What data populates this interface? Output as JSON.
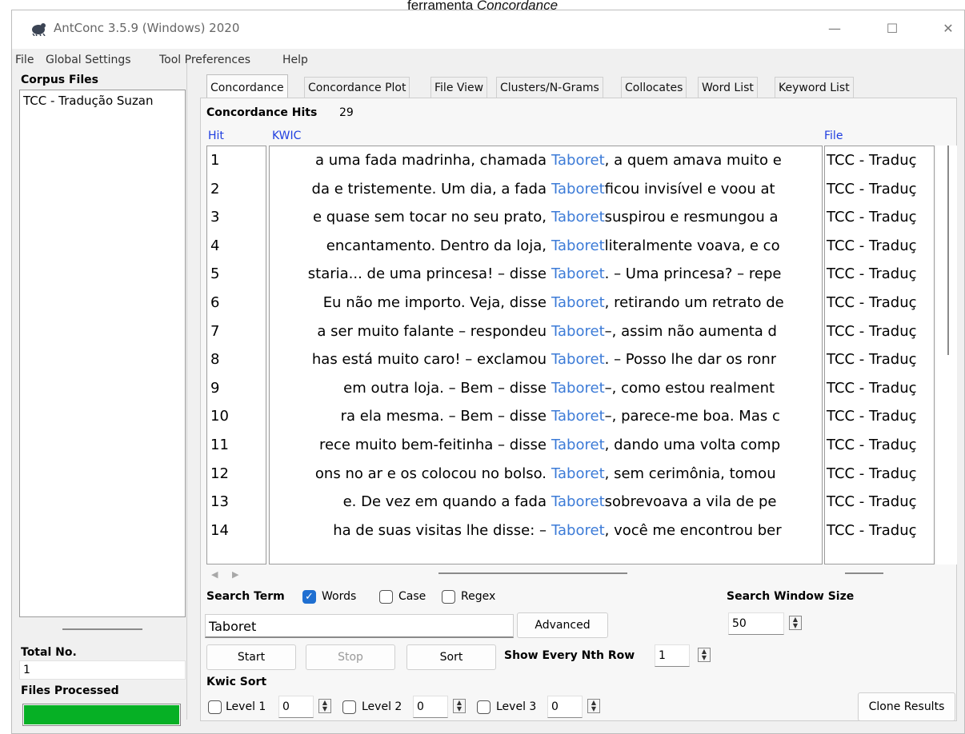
{
  "caption": {
    "main": "ferramenta",
    "italic": "Concordance"
  },
  "window": {
    "title": "AntConc 3.5.9 (Windows) 2020",
    "minimize": "—",
    "maximize": "☐",
    "close": "✕"
  },
  "menu": [
    "File",
    "Global Settings",
    "Tool Preferences",
    "Help"
  ],
  "left": {
    "corpus_files_label": "Corpus Files",
    "files": [
      "TCC - Tradução Suzan"
    ],
    "total_no_label": "Total No.",
    "total_no_value": "1",
    "files_processed_label": "Files Processed",
    "progress": 1.0
  },
  "tabs": [
    "Concordance",
    "Concordance Plot",
    "File View",
    "Clusters/N-Grams",
    "Collocates",
    "Word List",
    "Keyword List"
  ],
  "active_tab": "Concordance",
  "concordance": {
    "hits_label": "Concordance Hits",
    "hits_count": "29",
    "col_hit": "Hit",
    "col_kwic": "KWIC",
    "col_file": "File",
    "rows": [
      {
        "hit": "1",
        "left": "a uma fada madrinha, chamada",
        "keyword": "Taboret",
        "right": ", a quem amava muito e",
        "file": "TCC - Traduç"
      },
      {
        "hit": "2",
        "left": "da e tristemente.  Um dia, a fada",
        "keyword": "Taboret",
        "right": " ficou invisível e voou at",
        "file": "TCC - Traduç"
      },
      {
        "hit": "3",
        "left": "e quase sem tocar no seu prato,",
        "keyword": "Taboret",
        "right": " suspirou e resmungou a",
        "file": "TCC - Traduç"
      },
      {
        "hit": "4",
        "left": "encantamento.  Dentro da loja,",
        "keyword": "Taboret",
        "right": " literalmente voava, e co",
        "file": "TCC - Traduç"
      },
      {
        "hit": "5",
        "left": "staria... de uma princesa! – disse",
        "keyword": "Taboret",
        "right": ".  – Uma princesa? – repe",
        "file": "TCC - Traduç"
      },
      {
        "hit": "6",
        "left": "Eu não me importo. Veja, disse",
        "keyword": "Taboret",
        "right": ", retirando um retrato de",
        "file": "TCC - Traduç"
      },
      {
        "hit": "7",
        "left": "a ser muito falante – respondeu",
        "keyword": "Taboret",
        "right": " –, assim não aumenta d",
        "file": "TCC - Traduç"
      },
      {
        "hit": "8",
        "left": "has está muito caro! – exclamou",
        "keyword": "Taboret",
        "right": ". – Posso lhe dar os ronr",
        "file": "TCC - Traduç"
      },
      {
        "hit": "9",
        "left": "em outra loja.      – Bem – disse",
        "keyword": "Taboret",
        "right": " –, como estou realment",
        "file": "TCC - Traduç"
      },
      {
        "hit": "10",
        "left": "ra ela mesma.      – Bem – disse",
        "keyword": "Taboret",
        "right": " –, parece-me boa. Mas c",
        "file": "TCC - Traduç"
      },
      {
        "hit": "11",
        "left": "rece muito bem-feitinha – disse",
        "keyword": "Taboret",
        "right": ", dando uma volta comp",
        "file": "TCC - Traduç"
      },
      {
        "hit": "12",
        "left": "ons no ar e os colocou no bolso.",
        "keyword": "Taboret",
        "right": ", sem cerimônia, tomou",
        "file": "TCC - Traduç"
      },
      {
        "hit": "13",
        "left": "e.      De vez em quando a fada",
        "keyword": "Taboret",
        "right": " sobrevoava a vila de pe",
        "file": "TCC - Traduç"
      },
      {
        "hit": "14",
        "left": "ha de suas visitas lhe disse:      –",
        "keyword": "Taboret",
        "right": ", você me encontrou ber",
        "file": "TCC - Traduç"
      }
    ]
  },
  "search": {
    "label": "Search Term",
    "words_label": "Words",
    "words_checked": true,
    "case_label": "Case",
    "regex_label": "Regex",
    "term": "Taboret",
    "advanced_label": "Advanced",
    "window_size_label": "Search Window Size",
    "window_size": "50"
  },
  "buttons": {
    "start": "Start",
    "stop": "Stop",
    "sort": "Sort",
    "clone": "Clone Results"
  },
  "nth_row": {
    "label": "Show Every Nth Row",
    "value": "1"
  },
  "kwic_sort": {
    "label": "Kwic Sort",
    "levels": [
      {
        "label": "Level 1",
        "value": "0"
      },
      {
        "label": "Level 2",
        "value": "0"
      },
      {
        "label": "Level 3",
        "value": "0"
      }
    ]
  }
}
